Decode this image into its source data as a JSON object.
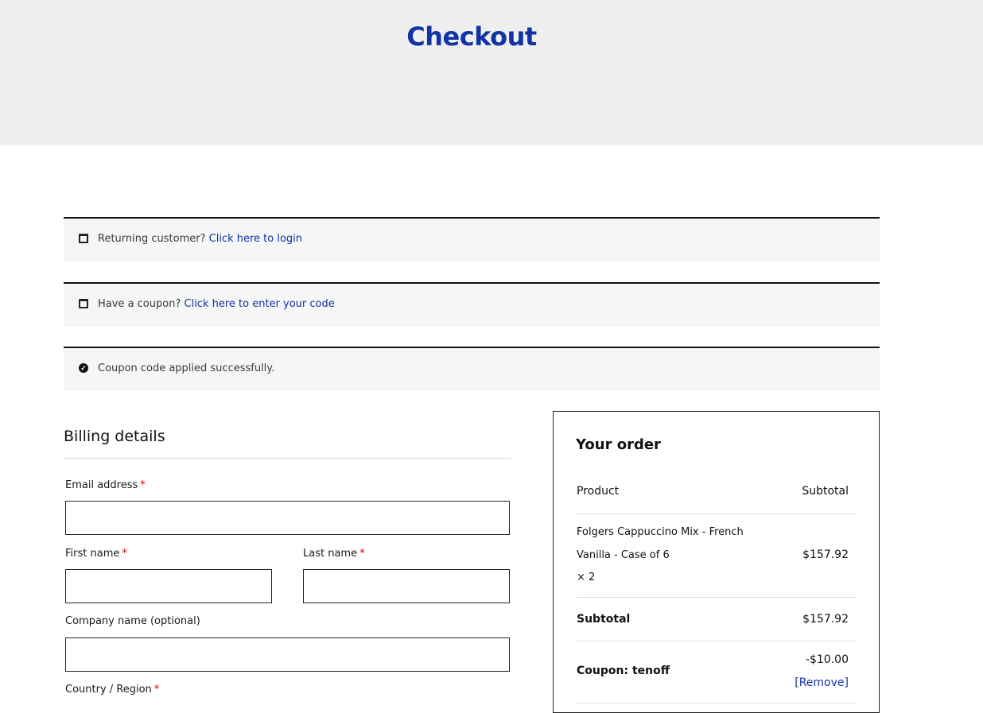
{
  "page": {
    "title": "Checkout"
  },
  "notices": {
    "login": {
      "text": "Returning customer?",
      "link": "Click here to login"
    },
    "coupon": {
      "text": "Have a coupon?",
      "link": "Click here to enter your code"
    },
    "applied": {
      "text": "Coupon code applied successfully."
    }
  },
  "billing": {
    "title": "Billing details",
    "email_label": "Email address",
    "first_name_label": "First name",
    "last_name_label": "Last name",
    "company_label": "Company name (optional)",
    "country_label": "Country / Region",
    "required_mark": "*"
  },
  "order": {
    "title": "Your order",
    "product_header": "Product",
    "subtotal_header": "Subtotal",
    "items": [
      {
        "name_line1": "Folgers Cappuccino Mix - French",
        "name_line2": "Vanilla - Case of 6",
        "qty": "× 2",
        "price": "$157.92"
      }
    ],
    "subtotal_label": "Subtotal",
    "subtotal_value": "$157.92",
    "coupon_label": "Coupon: tenoff",
    "coupon_value": "-$10.00",
    "remove_label": "[Remove]"
  },
  "colors": {
    "accent": "#1133a4",
    "hero_bg": "#efeff0",
    "notice_bg": "#f6f6f6",
    "required": "#d00000"
  }
}
